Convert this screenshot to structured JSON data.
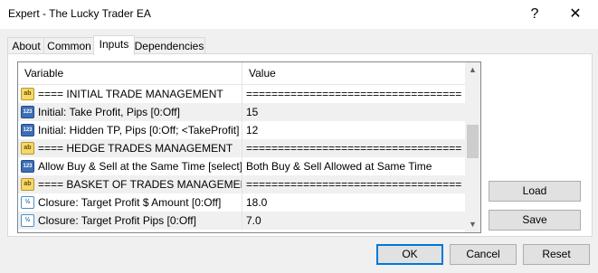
{
  "window": {
    "title": "Expert - The Lucky Trader EA",
    "help_glyph": "?",
    "close_glyph": "✕"
  },
  "tabs": [
    {
      "label": "About",
      "active": false
    },
    {
      "label": "Common",
      "active": false
    },
    {
      "label": "Inputs",
      "active": true
    },
    {
      "label": "Dependencies",
      "active": false
    }
  ],
  "grid": {
    "columns": [
      "Variable",
      "Value"
    ],
    "rows": [
      {
        "icon": "string-icon",
        "icon_text": "ab",
        "variable": "==== INITIAL TRADE MANAGEMENT",
        "value": "=================================="
      },
      {
        "icon": "integer-icon",
        "icon_text": "123",
        "variable": "Initial: Take Profit, Pips [0:Off]",
        "value": "15"
      },
      {
        "icon": "integer-icon",
        "icon_text": "123",
        "variable": "Initial: Hidden TP, Pips [0:Off; <TakeProfit]",
        "value": "12"
      },
      {
        "icon": "string-icon",
        "icon_text": "ab",
        "variable": "==== HEDGE TRADES MANAGEMENT",
        "value": "=================================="
      },
      {
        "icon": "enum-icon",
        "icon_text": "123",
        "variable": "Allow Buy & Sell at the Same Time [select]",
        "value": "Both Buy & Sell Allowed at Same Time"
      },
      {
        "icon": "string-icon",
        "icon_text": "ab",
        "variable": "==== BASKET OF TRADES MANAGEMENT",
        "value": "=================================="
      },
      {
        "icon": "double-icon",
        "icon_text": "½",
        "variable": "Closure: Target Profit $ Amount [0:Off]",
        "value": "18.0"
      },
      {
        "icon": "double-icon",
        "icon_text": "½",
        "variable": "Closure: Target Profit Pips [0:Off]",
        "value": "7.0"
      }
    ],
    "scroll_up_glyph": "▲",
    "scroll_down_glyph": "▼"
  },
  "side_buttons": {
    "load": "Load",
    "save": "Save"
  },
  "footer_buttons": {
    "ok": "OK",
    "cancel": "Cancel",
    "reset": "Reset"
  }
}
